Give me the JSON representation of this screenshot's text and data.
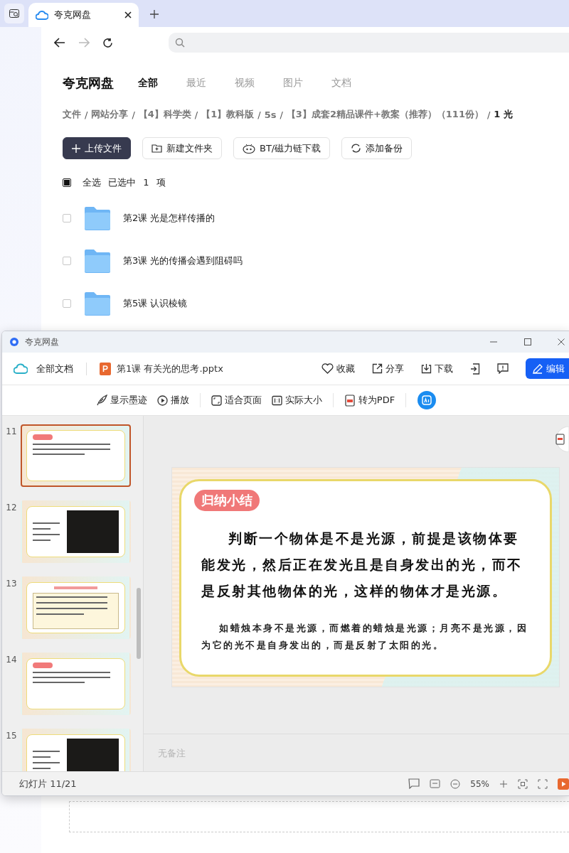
{
  "browser": {
    "tabs": [
      {
        "title": "夸克网盘",
        "selected": true
      }
    ]
  },
  "header": {
    "logo": "夸克网盘",
    "nav": [
      {
        "label": "全部",
        "selected": true
      },
      {
        "label": "最近",
        "selected": false
      },
      {
        "label": "视频",
        "selected": false
      },
      {
        "label": "图片",
        "selected": false
      },
      {
        "label": "文档",
        "selected": false
      }
    ]
  },
  "breadcrumb": [
    {
      "label": "文件",
      "separator": "/"
    },
    {
      "label": "网站分享",
      "separator": "/"
    },
    {
      "label": "【4】科学类",
      "separator": "/"
    },
    {
      "label": "【1】教科版",
      "separator": "/"
    },
    {
      "label": "5s",
      "separator": "/"
    },
    {
      "label": "【3】成套2精品课件+教案（推荐）（111份）",
      "separator": "/"
    },
    {
      "label": "1 光"
    }
  ],
  "actions": [
    {
      "label": "上传文件",
      "kind": "upload"
    },
    {
      "label": "新建文件夹",
      "kind": "folder"
    },
    {
      "label": "BT/磁力链下载",
      "kind": "bt"
    },
    {
      "label": "添加备份",
      "kind": "backup"
    }
  ],
  "selection": {
    "checked": true,
    "select_all": "全选",
    "summary": "已选中 1 项"
  },
  "files": [
    {
      "name": "第2课 光是怎样传播的",
      "checked": false
    },
    {
      "name": "第3课 光的传播会遇到阻碍吗",
      "checked": false
    },
    {
      "name": "第5课 认识棱镜",
      "checked": false
    }
  ],
  "viewer": {
    "app_title": "夸克网盘",
    "home": "全部文档",
    "file_name": "第1课 有关光的思考.pptx",
    "actions": [
      {
        "label": "收藏",
        "kind": "favorite"
      },
      {
        "label": "分享",
        "kind": "share"
      },
      {
        "label": "下载",
        "kind": "download"
      },
      {
        "kind": "export"
      },
      {
        "kind": "feedback"
      }
    ],
    "edit": "编辑",
    "tools": [
      {
        "label": "显示墨迹",
        "kind": "ink"
      },
      {
        "label": "播放",
        "kind": "play"
      },
      {
        "label": "适合页面",
        "kind": "fit"
      },
      {
        "label": "实际大小",
        "kind": "actual"
      },
      {
        "label": "转为PDF",
        "kind": "pdf"
      }
    ],
    "thumbnails": [
      {
        "number": "11",
        "kind": "summary",
        "selected": true
      },
      {
        "number": "12",
        "kind": "photo",
        "selected": false
      },
      {
        "number": "13",
        "kind": "table",
        "selected": false
      },
      {
        "number": "14",
        "kind": "summary",
        "selected": false
      },
      {
        "number": "15",
        "kind": "photo",
        "selected": false
      }
    ],
    "slide": {
      "badge": "归纳小结",
      "main_text": "判断一个物体是不是光源，前提是该物体要能发光，然后正在发光且是自身发出的光，而不是反射其他物体的光，这样的物体才是光源。",
      "note_text": "如蜡烛本身不是光源，而燃着的蜡烛是光源；月亮不是光源，因为它的光不是自身发出的，而是反射了太阳的光。"
    },
    "notes_placeholder": "无备注",
    "status": {
      "slide_counter": "幻灯片 11/21",
      "zoom": "55%"
    }
  }
}
